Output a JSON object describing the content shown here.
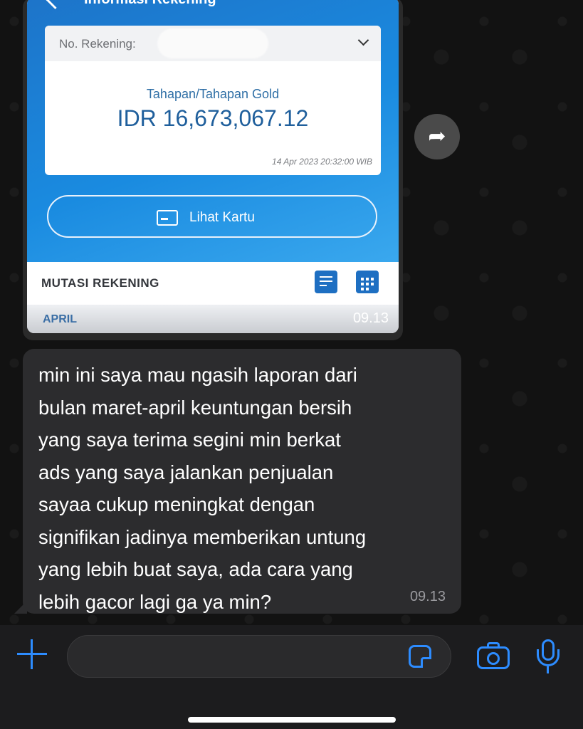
{
  "image_message": {
    "screen_title": "Informasi Rekening",
    "account_label": "No. Rekening:",
    "account_type": "Tahapan/Tahapan Gold",
    "balance": "IDR 16,673,067.12",
    "balance_timestamp": "14 Apr 2023 20:32:00 WIB",
    "card_button_label": "Lihat Kartu",
    "mutasi_title": "MUTASI REKENING",
    "month": "APRIL",
    "time": "09.13"
  },
  "text_message": {
    "body": "min ini saya mau ngasih laporan dari\nbulan maret-april keuntungan bersih\nyang saya terima segini min berkat\nads yang saya jalankan penjualan\nsayaa cukup meningkat dengan\nsignifikan jadinya memberikan untung\nyang lebih buat saya, ada cara yang\nlebih gacor lagi ga ya min?",
    "time": "09.13"
  },
  "input_bar": {
    "value": ""
  },
  "icons": {
    "forward": "forward-arrow-icon",
    "plus": "plus-icon",
    "sticker": "sticker-icon",
    "camera": "camera-icon",
    "microphone": "microphone-icon"
  },
  "colors": {
    "accent": "#2d8cff",
    "bank_blue": "#1d74c9",
    "bubble": "#2c2c2e",
    "background": "#121212"
  }
}
